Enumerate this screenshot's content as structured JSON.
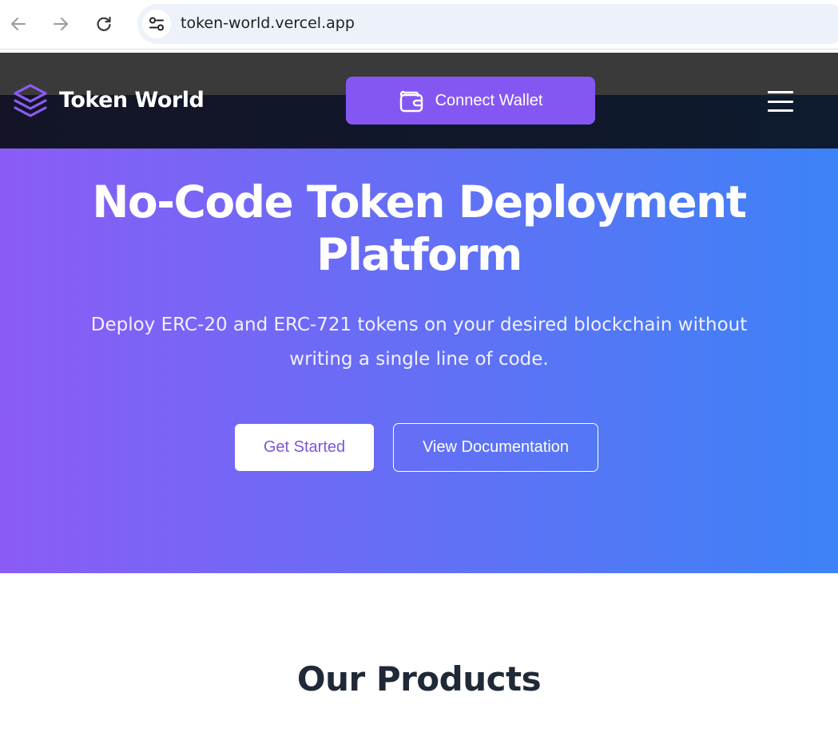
{
  "browser": {
    "url": "token-world.vercel.app",
    "icons": [
      "back-arrow-icon",
      "forward-arrow-icon",
      "reload-icon",
      "site-settings-icon"
    ]
  },
  "header": {
    "logo_text": "Token World",
    "logo_icon": "layers-icon",
    "connect_wallet_label": "Connect Wallet",
    "connect_wallet_icon": "wallet-icon",
    "menu_icon": "hamburger-menu-icon"
  },
  "hero": {
    "title": "No-Code Token Deployment Platform",
    "subtitle": "Deploy ERC-20 and ERC-721 tokens on your desired blockchain without writing a single line of code.",
    "primary_button": "Get Started",
    "secondary_button": "View Documentation"
  },
  "products": {
    "title": "Our Products"
  },
  "colors": {
    "accent": "#8557f2",
    "hero_gradient_start": "#8b5cf6",
    "hero_gradient_end": "#3d82f6",
    "header_bg": "#131526",
    "heading_dark": "#1f2937"
  }
}
